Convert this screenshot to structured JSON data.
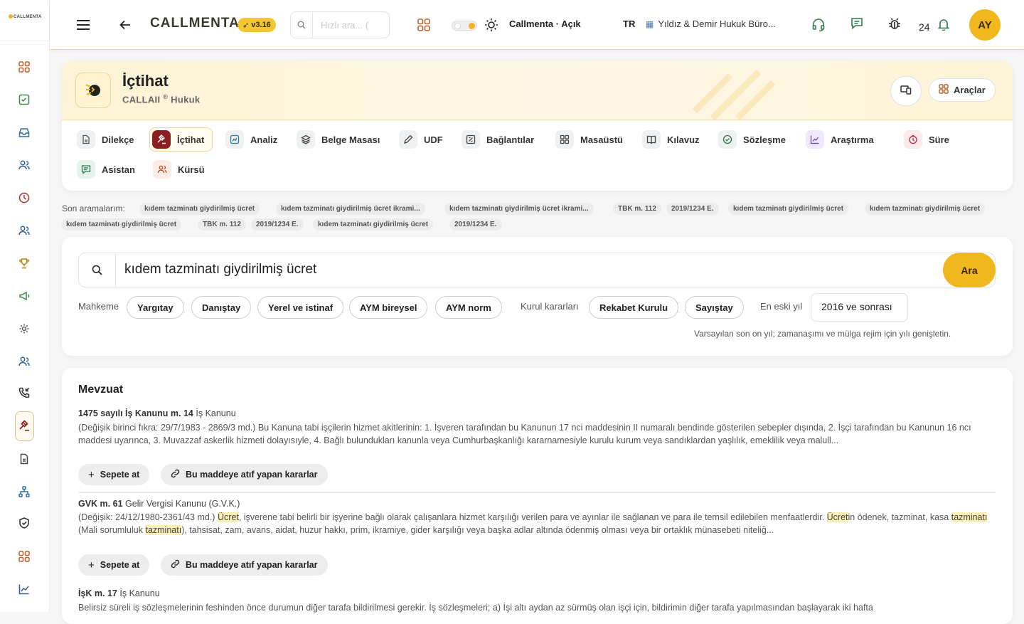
{
  "app": {
    "logo_text": "CALLMENTA",
    "brand": "CALLMENTA",
    "version": "v3.16"
  },
  "topbar": {
    "search_placeholder": "Hızlı ara... (",
    "theme_label": "Callmenta · Açık",
    "lang": "TR",
    "firm": "Yıldız & Demir Hukuk Büro...",
    "notifications": "24",
    "avatar": "AY"
  },
  "sidebar": {
    "items": [
      "dashboard-icon",
      "tasks-icon",
      "inbox-icon",
      "users-icon",
      "clock-icon",
      "team-icon",
      "trophy-icon",
      "megaphone-icon",
      "settings-cog-icon",
      "people-icon",
      "phone-incoming-icon",
      "gavel-icon",
      "document-icon",
      "hierarchy-icon",
      "shield-check-icon",
      "grid-icon",
      "chart-icon"
    ]
  },
  "module": {
    "title": "İçtihat",
    "subtitle": "CALLAII",
    "subtitle_reg": "®",
    "subtitle_tail": "Hukuk",
    "tools_label": "Araçlar"
  },
  "tabs": [
    {
      "label": "Dilekçe",
      "icon": "document-icon"
    },
    {
      "label": "İçtihat",
      "icon": "gavel-icon",
      "active": true
    },
    {
      "label": "Analiz",
      "icon": "analysis-icon"
    },
    {
      "label": "Belge Masası",
      "icon": "layers-icon"
    },
    {
      "label": "UDF",
      "icon": "pen-icon"
    },
    {
      "label": "Bağlantılar",
      "icon": "link-icon"
    },
    {
      "label": "Masaüstü",
      "icon": "grid-icon"
    },
    {
      "label": "Kılavuz",
      "icon": "book-icon"
    },
    {
      "label": "Sözleşme",
      "icon": "check-badge-icon"
    },
    {
      "label": "Araştırma",
      "icon": "chart-icon"
    },
    {
      "label": "Süre",
      "icon": "timer-icon"
    },
    {
      "label": "Asistan",
      "icon": "chat-icon"
    },
    {
      "label": "Kürsü",
      "icon": "users-icon"
    }
  ],
  "recent": {
    "label": "Son aramalarım:",
    "items": [
      "kıdem tazminatı giydirilmiş ücret",
      "kıdem tazminatı giydirilmiş ücret ikrami...",
      "kıdem tazminatı giydirilmiş ücret ikrami...",
      "TBK m. 112",
      "2019/1234 E.",
      "kıdem tazminatı giydirilmiş ücret",
      "kıdem tazminatı giydirilmiş ücret",
      "kıdem tazminatı giydirilmiş ücret",
      "TBK m. 112",
      "2019/1234 E.",
      "kıdem tazminatı giydirilmiş ücret",
      "2019/1234 E."
    ]
  },
  "search": {
    "query": "kıdem tazminatı giydirilmiş ücret",
    "button": "Ara",
    "court_label": "Mahkeme",
    "courts": [
      "Yargıtay",
      "Danıştay",
      "Yerel ve istinaf",
      "AYM bireysel",
      "AYM norm"
    ],
    "board_label": "Kurul kararları",
    "boards": [
      "Rekabet Kurulu",
      "Sayıştay"
    ],
    "year_label": "En eski yıl",
    "year_value": "2016 ve sonrası",
    "hint": "Varsayılan son on yıl; zamanaşımı ve mülga rejim için yılı genişletin."
  },
  "results": {
    "title": "Mevzuat",
    "basket_label": "Sepete at",
    "cite_label": "Bu maddeye atıf yapan kararlar",
    "items": [
      {
        "ref": "1475 sayılı İş Kanunu m. 14",
        "law": "İş Kanunu",
        "text": "(Değişik birinci fıkra: 29/7/1983 - 2869/3 md.) Bu Kanuna tabi işçilerin hizmet akitlerinin: 1. İşveren tarafından bu Kanunun 17 nci maddesinin II numaralı bendinde gösterilen sebepler dışında, 2. İşçi tarafından bu Kanunun 16 ncı maddesi uyarınca, 3. Muvazzaf askerlik hizmeti dolayısıyle, 4. Bağlı bulundukları kanunla veya Cumhurbaşkanlığı kararnamesiyle kurulu kurum veya sandıklardan yaşlılık, emeklilik veya malull..."
      },
      {
        "ref": "GVK m. 61",
        "law": "Gelir Vergisi Kanunu (G.V.K.)",
        "t1": "(Değişik: 24/12/1980-2361/43 md.) ",
        "h1": "Ücret",
        "t2": ", işverene tabi belirli bir işyerine bağlı olarak çalışanlara hizmet karşılığı verilen para ve ayınlar ile sağlanan ve para ile temsil edilebilen menfaatlerdir. ",
        "h2": "Ücret",
        "t3": "in ödenek, tazminat, kasa ",
        "h3": "tazminatı",
        "t4": " (Mali sorumluluk ",
        "h4": "tazminatı",
        "t5": "), tahsisat, zam, avans, aidat, huzur hakkı, prim, ikramiye, gider karşılığı veya başka adlar altında ödenmiş olması veya bir ortaklık münasebeti niteliğ..."
      },
      {
        "ref": "İşK m. 17",
        "law": "İş Kanunu",
        "text": "Belirsiz süreli iş sözleşmelerinin feshinden önce durumun diğer tarafa bildirilmesi gerekir. İş sözleşmeleri; a) İşi altı aydan az sürmüş olan işçi için, bildirimin diğer tarafa yapılmasından başlayarak iki hafta"
      }
    ]
  },
  "colors": {
    "accent": "#f1b81e",
    "active_tab_icon": "#8b1f1f",
    "highlight": "#fcefb5"
  }
}
